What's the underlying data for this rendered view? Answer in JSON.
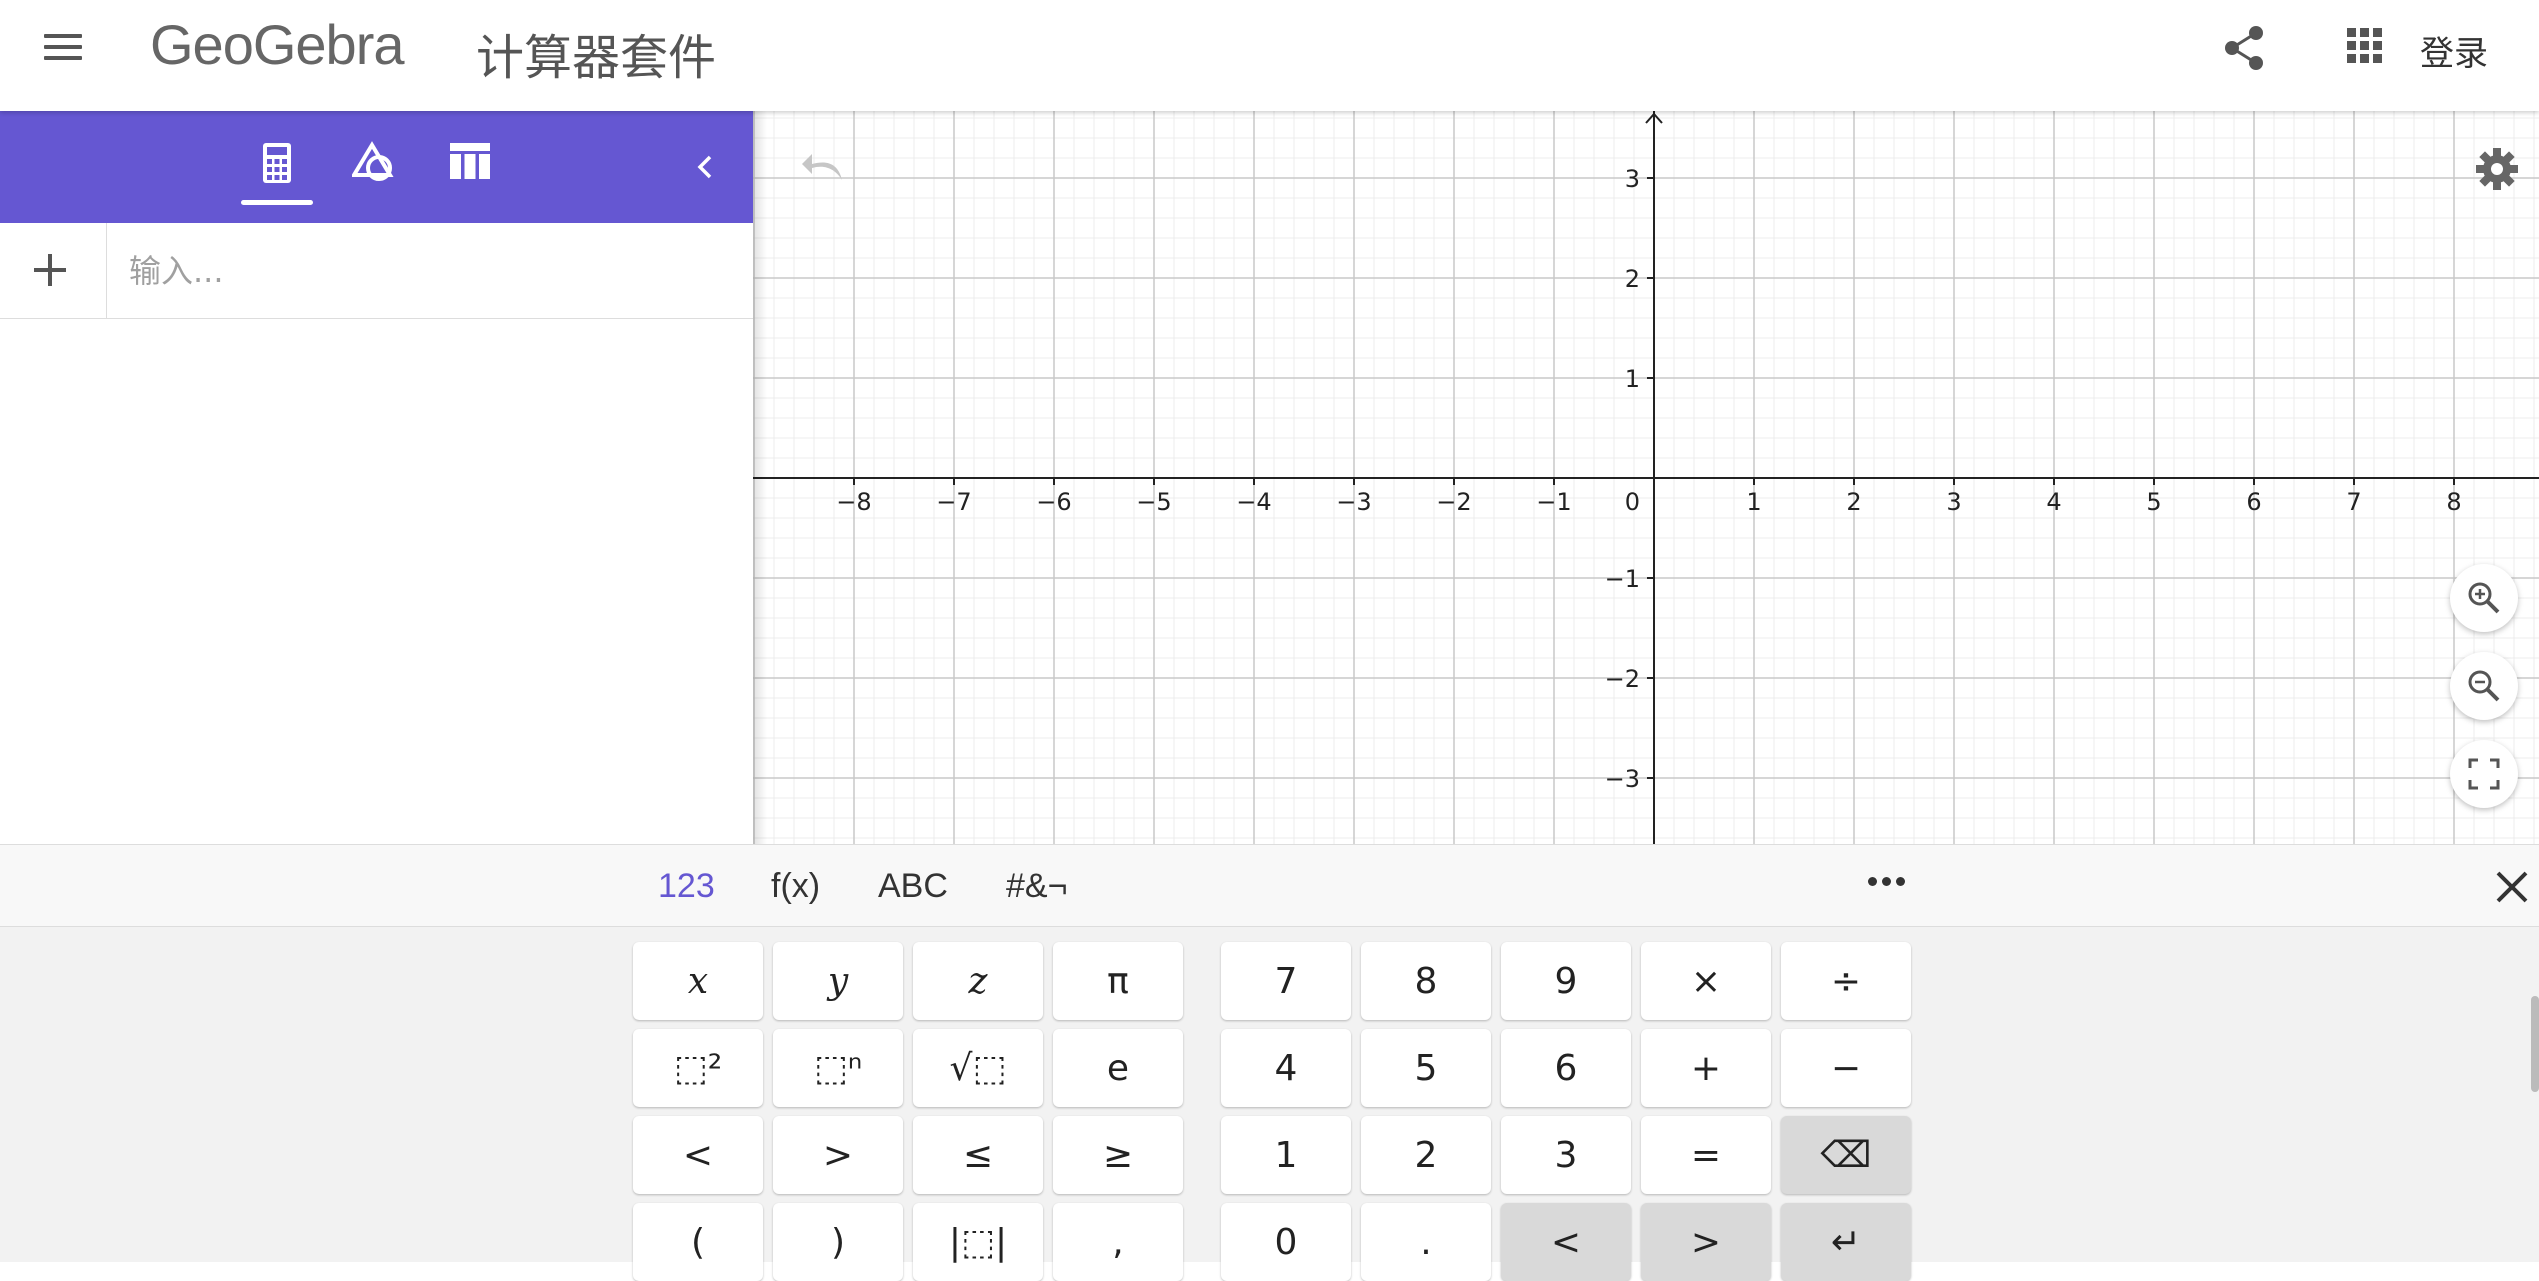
{
  "header": {
    "logo": "GeoGebra",
    "app_title": "计算器套件",
    "login_label": "登录",
    "icons": [
      "menu-icon",
      "share-icon",
      "apps-grid-icon"
    ]
  },
  "algebra": {
    "tabs": [
      "calculator-icon",
      "geometry-icon",
      "table-icon"
    ],
    "input_placeholder": "输入..."
  },
  "graphics": {
    "x_ticks": [
      "−8",
      "−7",
      "−6",
      "−5",
      "−4",
      "−3",
      "−2",
      "−1",
      "1",
      "2",
      "3",
      "4",
      "5",
      "6",
      "7",
      "8"
    ],
    "y_ticks": [
      "3",
      "2",
      "1",
      "−1",
      "−2",
      "−3"
    ],
    "origin_label": "0",
    "icons": [
      "undo-icon",
      "settings-icon",
      "zoom-in-icon",
      "zoom-out-icon",
      "fullscreen-icon"
    ]
  },
  "keyboard": {
    "tabs": [
      "123",
      "f(x)",
      "ABC",
      "#&¬"
    ],
    "active_tab": "123",
    "left_keys": [
      [
        "x",
        "y",
        "z",
        "π"
      ],
      [
        "⬚²",
        "⬚ⁿ",
        "√⬚",
        "e"
      ],
      [
        "<",
        ">",
        "≤",
        "≥"
      ],
      [
        "(",
        ")",
        "|⬚|",
        ","
      ]
    ],
    "right_keys": [
      [
        "7",
        "8",
        "9",
        "×",
        "÷"
      ],
      [
        "4",
        "5",
        "6",
        "+",
        "−"
      ],
      [
        "1",
        "2",
        "3",
        "=",
        "⌫"
      ],
      [
        "0",
        ".",
        "<",
        ">",
        "↵"
      ]
    ]
  }
}
